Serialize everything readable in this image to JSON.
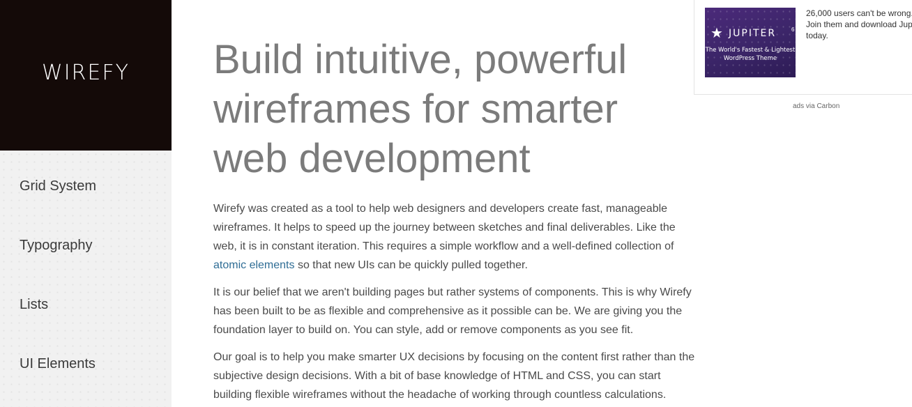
{
  "sidebar": {
    "logo": "WIREFY",
    "items": [
      {
        "label": "Grid System"
      },
      {
        "label": "Typography"
      },
      {
        "label": "Lists"
      },
      {
        "label": "UI Elements"
      }
    ]
  },
  "main": {
    "headline": [
      "Build intuitive, powerful",
      "wireframes for smarter",
      "web development"
    ],
    "p1": {
      "lines": [
        "Wirefy was created as a tool to help web designers and developers create fast, manageable",
        "wireframes. It helps to speed up the journey between sketches and final deliverables. Like the",
        "web, it is in constant iteration. This requires a simple workflow and a well-defined collection of"
      ],
      "link": "atomic elements",
      "tail": " so that new UIs can be quickly pulled together."
    },
    "p2": [
      "It is our belief that we aren't building pages but rather systems of components. This is why Wirefy",
      "has been built to be as flexible and comprehensive as it possible can be. We are giving you the",
      "foundation layer to build on. You can style, add or remove components as you see fit."
    ],
    "p3": [
      "Our goal is to help you make smarter UX decisions by focusing on the content first rather than the",
      "subjective design decisions. With a bit of base knowledge of HTML and CSS, you can start",
      "building flexible wireframes without the headache of working through countless calculations."
    ]
  },
  "ad": {
    "image": {
      "brand": "JUPITER",
      "version": "6",
      "tagline": [
        "The World's Fastest & Lightest",
        "WordPress Theme"
      ],
      "icon": "star-icon",
      "background": "#3b2568"
    },
    "copy": [
      "26,000 users can't be wrong.",
      "Join them and download Jupiter",
      "today."
    ],
    "credit": "ads via Carbon"
  },
  "colors": {
    "brand_bg": "#140a08",
    "nav_bg": "#f1f1f1",
    "link": "#2f6d95",
    "headline": "#7b7b7b"
  }
}
